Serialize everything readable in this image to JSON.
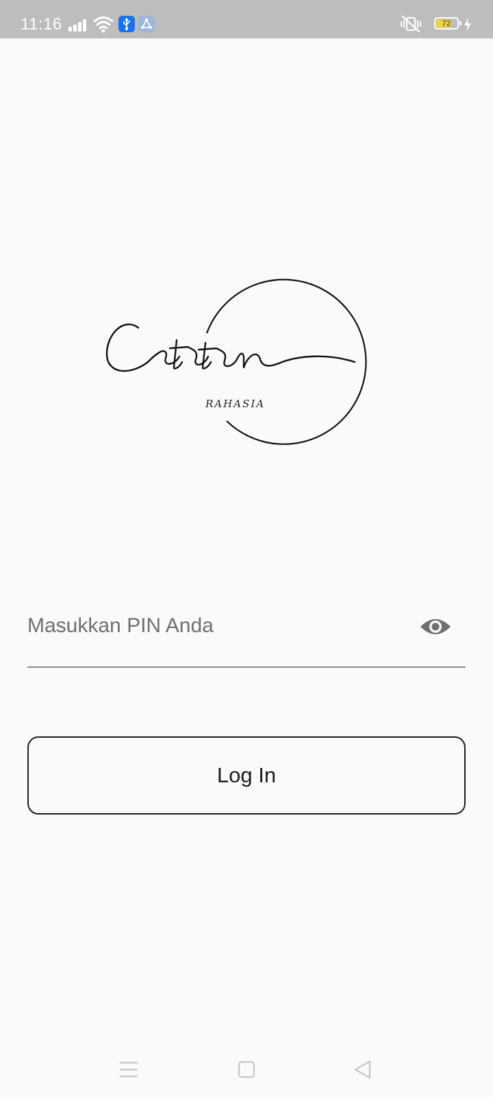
{
  "status_bar": {
    "time": "11:16",
    "battery_level": "72",
    "battery_fraction": 0.72,
    "icons": [
      "signal-icon",
      "wifi-icon",
      "usb-icon",
      "app-notification-icon",
      "vibrate-icon",
      "battery-icon",
      "charging-icon"
    ],
    "badge_colors": {
      "usb": "#1a73e8",
      "app": "#9fb6d9"
    }
  },
  "logo": {
    "title": "Catatan",
    "subtitle": "RAHASIA"
  },
  "pin_field": {
    "value": "",
    "placeholder": "Masukkan PIN Anda",
    "toggle_icon": "eye-icon"
  },
  "login_button": {
    "label": "Log In"
  },
  "nav_bar": {
    "icons": [
      "menu-icon",
      "home-icon",
      "back-icon"
    ]
  },
  "colors": {
    "background": "#fafafa",
    "status_bar": "#bdbdbd",
    "text": "#1c1c1c",
    "placeholder": "#6f6f6f",
    "underline": "#8a8a8a",
    "battery_fill": "#f2d33b"
  }
}
